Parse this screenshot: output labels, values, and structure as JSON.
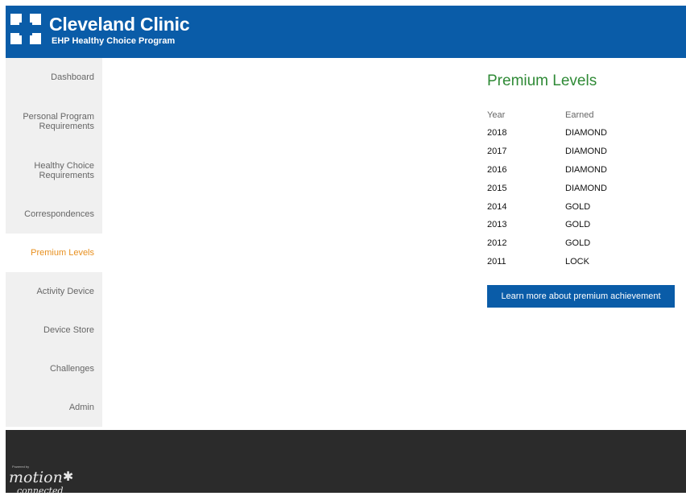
{
  "header": {
    "brand_name": "Cleveland Clinic",
    "program_name": "EHP Healthy Choice Program",
    "logo_icon": "cleveland-clinic-logo",
    "background_color": "#0a5ca8"
  },
  "sidebar": {
    "items": [
      {
        "label": "Dashboard",
        "active": false
      },
      {
        "label": "Personal Program Requirements",
        "line1": "Personal Program",
        "line2": "Requirements",
        "active": false
      },
      {
        "label": "Healthy Choice Requirements",
        "line1": "Healthy Choice",
        "line2": "Requirements",
        "active": false
      },
      {
        "label": "Correspondences",
        "active": false
      },
      {
        "label": "Premium Levels",
        "active": true
      },
      {
        "label": "Activity Device",
        "active": false
      },
      {
        "label": "Device Store",
        "active": false
      },
      {
        "label": "Challenges",
        "active": false
      },
      {
        "label": "Admin",
        "active": false
      }
    ],
    "active_color": "#e8901f"
  },
  "main": {
    "title": "Premium Levels",
    "title_color": "#2f8a36",
    "table": {
      "headers": [
        "Year",
        "Earned"
      ],
      "rows": [
        {
          "year": "2018",
          "earned": "DIAMOND"
        },
        {
          "year": "2017",
          "earned": "DIAMOND"
        },
        {
          "year": "2016",
          "earned": "DIAMOND"
        },
        {
          "year": "2015",
          "earned": "DIAMOND"
        },
        {
          "year": "2014",
          "earned": "GOLD"
        },
        {
          "year": "2013",
          "earned": "GOLD"
        },
        {
          "year": "2012",
          "earned": "GOLD"
        },
        {
          "year": "2011",
          "earned": "LOCK"
        }
      ]
    },
    "learn_more_label": "Learn more about premium achievement"
  },
  "footer": {
    "tagline": "Powered by",
    "logo_text": "motion",
    "logo_star": "✱",
    "logo_sub": "connected",
    "background_color": "#2b2b2b"
  }
}
